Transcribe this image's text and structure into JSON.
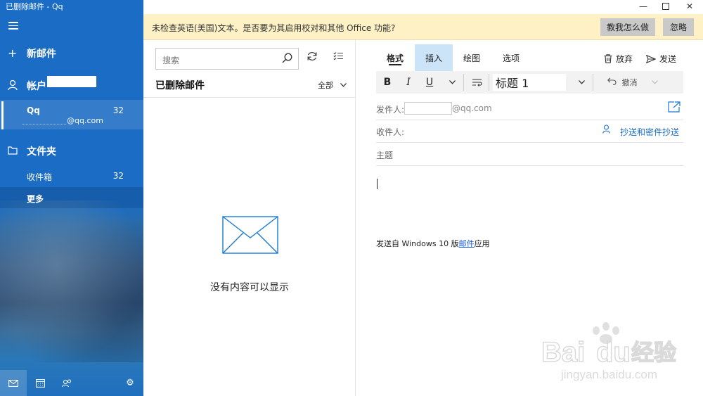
{
  "window": {
    "title": "已删除邮件 - Qq",
    "controls": [
      "minimize-icon",
      "maximize-icon",
      "close-icon"
    ]
  },
  "sidebar": {
    "new_mail": "新邮件",
    "accounts_label": "帐户",
    "account": {
      "name": "Qq",
      "count": "32",
      "email": "@qq.com"
    },
    "folders_label": "文件夹",
    "folder_items": [
      {
        "label": "收件箱",
        "count": "32"
      },
      {
        "label": "更多",
        "count": ""
      }
    ],
    "bottom_icons": [
      "mail-icon",
      "calendar-icon",
      "people-icon",
      "settings-icon"
    ]
  },
  "notice": {
    "message": "未检查英语(美国)文本。是否要为其启用校对和其他 Office 功能?",
    "teach_button": "教我怎么做",
    "ignore_button": "忽略"
  },
  "list": {
    "search_placeholder": "搜索",
    "title": "已删除邮件",
    "filter": "全部",
    "empty_text": "没有内容可以显示"
  },
  "compose": {
    "tabs": [
      {
        "label": "格式",
        "active": true
      },
      {
        "label": "插入",
        "highlight": true
      },
      {
        "label": "绘图"
      },
      {
        "label": "选项"
      }
    ],
    "discard": "放弃",
    "send": "发送",
    "toolbar": {
      "bold": "B",
      "italic": "I",
      "underline": "U",
      "style": "标题 1",
      "undo": "撤消"
    },
    "from_label": "发件人:",
    "from_suffix": "@qq.com",
    "to_label": "收件人:",
    "cc_link": "抄送和密件抄送",
    "subject_placeholder": "主题",
    "signature_prefix": "发送自 Windows 10 版",
    "signature_link": "邮件",
    "signature_suffix": "应用"
  },
  "watermark": {
    "brand": "Bai",
    "brand2": "du",
    "product": "经验",
    "url": "jingyan.baidu.com"
  },
  "colors": {
    "sidebar": "#1a6cc4",
    "notice_bg": "#fdf1c5",
    "tab_highlight": "#cce4f7",
    "link": "#1a6cc4"
  }
}
